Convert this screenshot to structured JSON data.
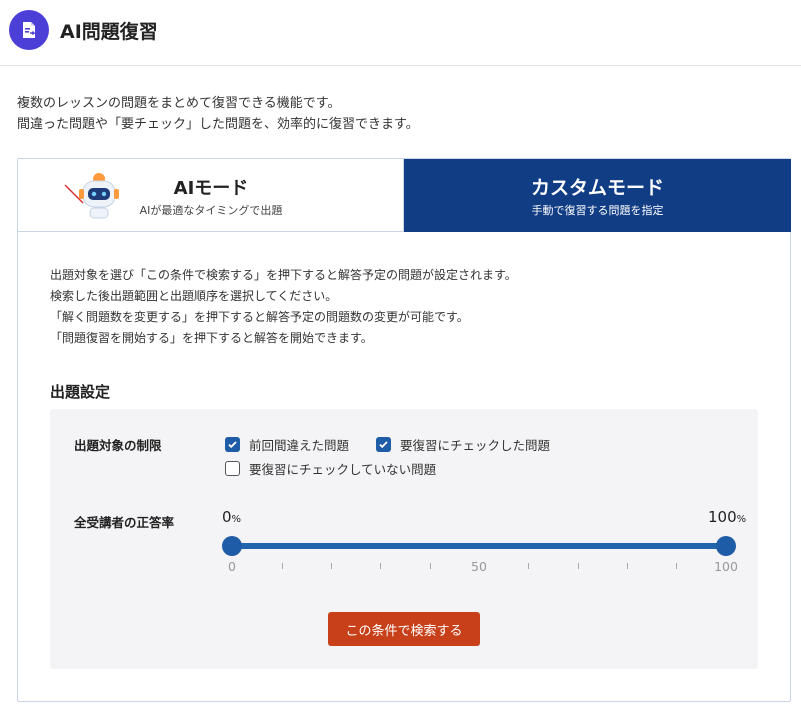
{
  "header": {
    "title": "AI問題復習"
  },
  "intro": {
    "line1": "複数のレッスンの問題をまとめて復習できる機能です。",
    "line2": "間違った問題や「要チェック」した問題を、効率的に復習できます。"
  },
  "tabs": {
    "ai": {
      "title": "AIモード",
      "subtitle": "AIが最適なタイミングで出題"
    },
    "custom": {
      "title": "カスタムモード",
      "subtitle": "手動で復習する問題を指定"
    }
  },
  "description": {
    "line1": "出題対象を選び「この条件で検索する」を押下すると解答予定の問題が設定されます。",
    "line2": "検索した後出題範囲と出題順序を選択してください。",
    "line3": "「解く問題数を変更する」を押下すると解答予定の問題数の変更が可能です。",
    "line4": "「問題復習を開始する」を押下すると解答を開始できます。"
  },
  "settings": {
    "title": "出題設定",
    "target_label": "出題対象の制限",
    "checkboxes": [
      {
        "label": "前回間違えた問題",
        "checked": true
      },
      {
        "label": "要復習にチェックした問題",
        "checked": true
      },
      {
        "label": "要復習にチェックしていない問題",
        "checked": false
      }
    ],
    "rate_label": "全受講者の正答率",
    "range": {
      "min_value": "0",
      "max_value": "100",
      "unit": "%",
      "ticks": [
        "0",
        "50",
        "100"
      ]
    },
    "search_button": "この条件で検索する"
  },
  "colors": {
    "accent": "#113d85",
    "slider": "#1e5ca8",
    "button": "#c7401a",
    "header_icon": "#4c3fd7"
  }
}
